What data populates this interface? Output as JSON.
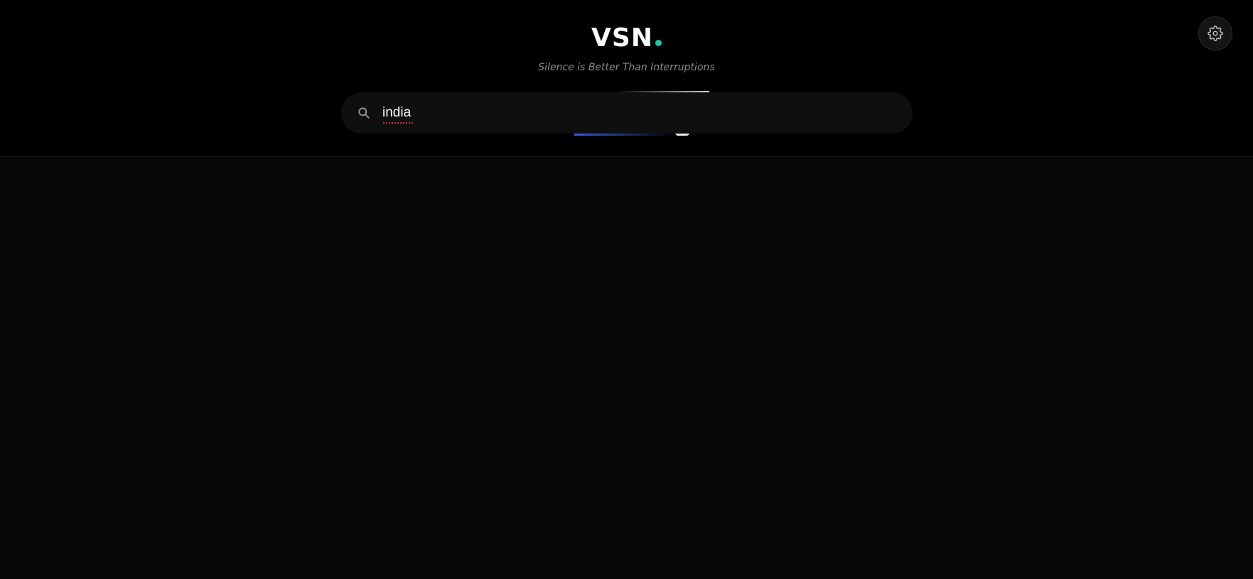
{
  "brand": {
    "name": "VSN",
    "dot_color": "#1cc9a0"
  },
  "tagline": "Silence is Better Than Interruptions",
  "search": {
    "value": "india",
    "icon": "search-icon"
  },
  "settings": {
    "icon": "gear-icon"
  },
  "colors": {
    "background": "#060606",
    "header": "#000000",
    "search_bg": "#0f0f0f",
    "accent_blue": "#3b5bdb"
  }
}
